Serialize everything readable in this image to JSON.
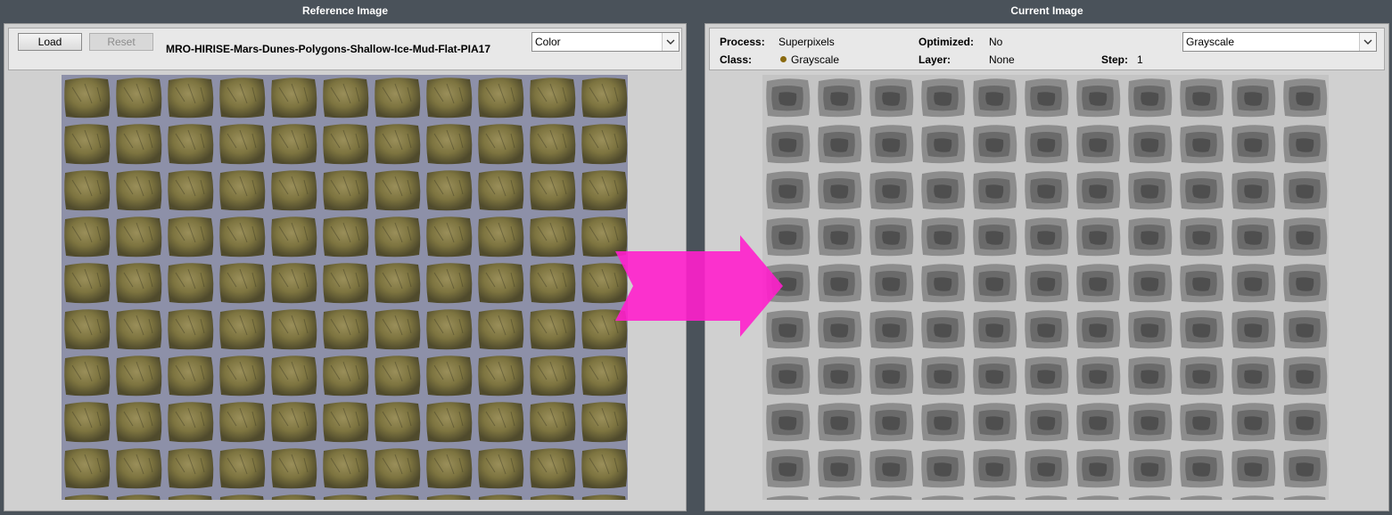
{
  "reference": {
    "title": "Reference Image",
    "load_label": "Load",
    "reset_label": "Reset",
    "file_name": "MRO-HIRISE-Mars-Dunes-Polygons-Shallow-Ice-Mud-Flat-PIA17",
    "file_name_line2": "",
    "mode_select": "Color"
  },
  "current": {
    "title": "Current Image",
    "process_label": "Process:",
    "process_value": "Superpixels",
    "optimized_label": "Optimized:",
    "optimized_value": "No",
    "class_label": "Class:",
    "class_value": "Grayscale",
    "layer_label": "Layer:",
    "layer_value": "None",
    "step_label": "Step:",
    "step_value": "1",
    "mode_select": "Grayscale"
  },
  "colors": {
    "background": "#4a525a",
    "arrow": "#ff1fcc",
    "class_dot": "#8a6a10"
  }
}
